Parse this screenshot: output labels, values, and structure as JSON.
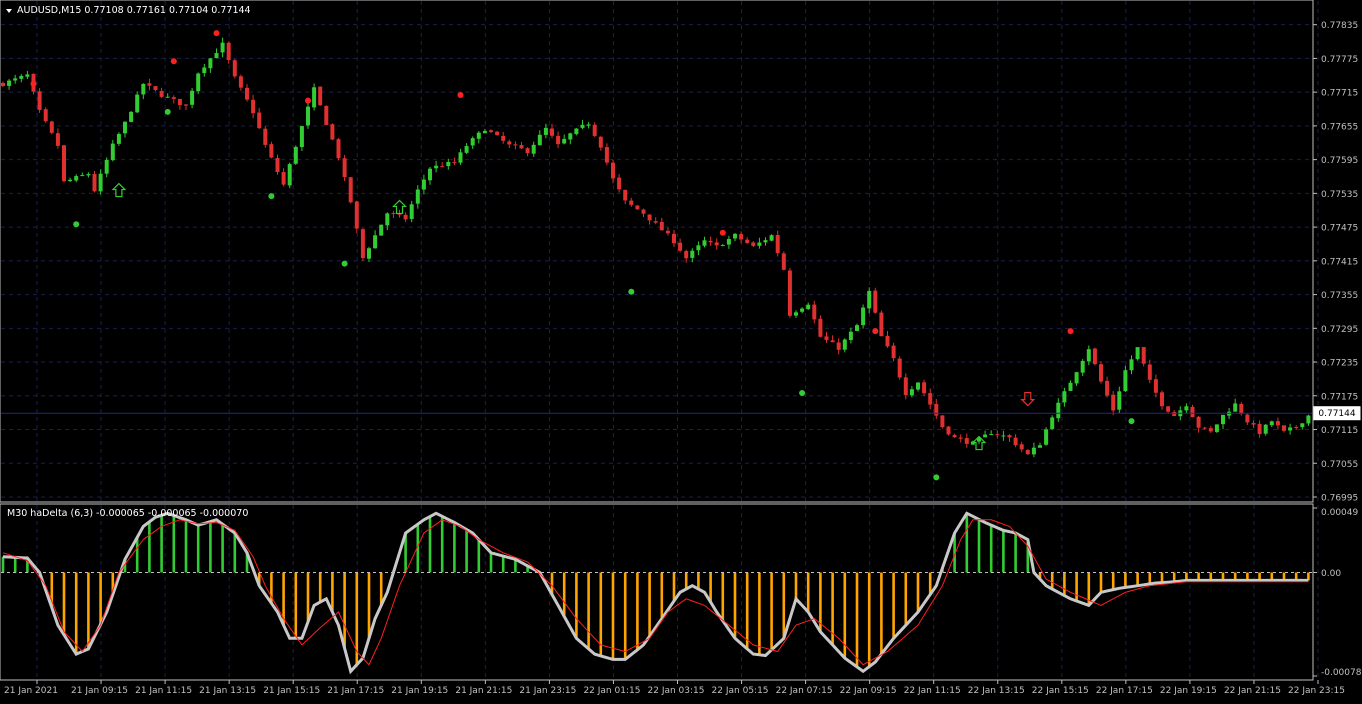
{
  "main_chart": {
    "header": "AUDUSD,M15  0.77108 0.77161 0.77104 0.77144",
    "current_price_label": "0.77144",
    "y_ticks": [
      "0.77835",
      "0.77775",
      "0.77715",
      "0.77655",
      "0.77595",
      "0.77535",
      "0.77475",
      "0.77415",
      "0.77355",
      "0.77295",
      "0.77235",
      "0.77175",
      "0.77115",
      "0.77055",
      "0.76995"
    ]
  },
  "indicator": {
    "header": "M30 haDelta (6,3) -0.000065 -0.000065 -0.000070",
    "y_ticks": [
      "0.00049",
      "0.00",
      "-0.000786"
    ]
  },
  "x_ticks": [
    "21 Jan 2021",
    "21 Jan 09:15",
    "21 Jan 11:15",
    "21 Jan 13:15",
    "21 Jan 15:15",
    "21 Jan 17:15",
    "21 Jan 19:15",
    "21 Jan 21:15",
    "21 Jan 23:15",
    "22 Jan 01:15",
    "22 Jan 03:15",
    "22 Jan 05:15",
    "22 Jan 07:15",
    "22 Jan 09:15",
    "22 Jan 11:15",
    "22 Jan 13:15",
    "22 Jan 15:15",
    "22 Jan 17:15",
    "22 Jan 19:15",
    "22 Jan 21:15",
    "22 Jan 23:15"
  ],
  "colors": {
    "background": "#000000",
    "grid": "#1a2050",
    "axis": "#c0c0c0",
    "bull": "#32cd32",
    "bear": "#e03030",
    "hist_pos": "#32cd32",
    "hist_neg": "#ffa500",
    "delta_line": "#c8c8c8",
    "signal_line": "#ff2020"
  },
  "chart_data": [
    {
      "type": "candlestick",
      "symbol": "AUDUSD",
      "timeframe": "M15",
      "ylim": [
        0.76995,
        0.7787
      ],
      "close_path": [
        [
          0,
          0.7773
        ],
        [
          4,
          0.77745
        ],
        [
          6,
          0.7768
        ],
        [
          9,
          0.7762
        ],
        [
          10,
          0.77555
        ],
        [
          14,
          0.7757
        ],
        [
          15,
          0.7754
        ],
        [
          18,
          0.7762
        ],
        [
          20,
          0.7766
        ],
        [
          23,
          0.7773
        ],
        [
          26,
          0.7771
        ],
        [
          30,
          0.7769
        ],
        [
          32,
          0.7775
        ],
        [
          36,
          0.778
        ],
        [
          38,
          0.7774
        ],
        [
          41,
          0.7768
        ],
        [
          43,
          0.7762
        ],
        [
          46,
          0.7755
        ],
        [
          48,
          0.7762
        ],
        [
          51,
          0.7772
        ],
        [
          53,
          0.7766
        ],
        [
          55,
          0.776
        ],
        [
          57,
          0.7752
        ],
        [
          59,
          0.7742
        ],
        [
          61,
          0.7746
        ],
        [
          63,
          0.775
        ],
        [
          66,
          0.7749
        ],
        [
          68,
          0.7754
        ],
        [
          70,
          0.7758
        ],
        [
          74,
          0.7759
        ],
        [
          76,
          0.7762
        ],
        [
          79,
          0.7765
        ],
        [
          83,
          0.7762
        ],
        [
          86,
          0.7761
        ],
        [
          89,
          0.7765
        ],
        [
          91,
          0.7762
        ],
        [
          93,
          0.7764
        ],
        [
          96,
          0.7766
        ],
        [
          98,
          0.7762
        ],
        [
          100,
          0.7756
        ],
        [
          102,
          0.7752
        ],
        [
          105,
          0.775
        ],
        [
          107,
          0.7748
        ],
        [
          110,
          0.7745
        ],
        [
          112,
          0.7742
        ],
        [
          115,
          0.7745
        ],
        [
          117,
          0.7744
        ],
        [
          120,
          0.7746
        ],
        [
          123,
          0.7744
        ],
        [
          126,
          0.7746
        ],
        [
          128,
          0.774
        ],
        [
          129,
          0.7732
        ],
        [
          132,
          0.7734
        ],
        [
          134,
          0.7728
        ],
        [
          137,
          0.7726
        ],
        [
          140,
          0.773
        ],
        [
          142,
          0.7736
        ],
        [
          144,
          0.7728
        ],
        [
          146,
          0.7724
        ],
        [
          148,
          0.7718
        ],
        [
          150,
          0.772
        ],
        [
          152,
          0.7716
        ],
        [
          154,
          0.7712
        ],
        [
          156,
          0.771
        ],
        [
          159,
          0.7709
        ],
        [
          162,
          0.7711
        ],
        [
          165,
          0.771
        ],
        [
          168,
          0.7707
        ],
        [
          170,
          0.7709
        ],
        [
          172,
          0.7714
        ],
        [
          174,
          0.7718
        ],
        [
          176,
          0.7722
        ],
        [
          178,
          0.7726
        ],
        [
          180,
          0.772
        ],
        [
          182,
          0.7715
        ],
        [
          184,
          0.7722
        ],
        [
          186,
          0.7726
        ],
        [
          188,
          0.772
        ],
        [
          190,
          0.7716
        ],
        [
          192,
          0.7714
        ],
        [
          194,
          0.7716
        ],
        [
          196,
          0.7712
        ],
        [
          198,
          0.7711
        ],
        [
          200,
          0.7714
        ],
        [
          202,
          0.7716
        ],
        [
          204,
          0.7713
        ],
        [
          206,
          0.7711
        ],
        [
          208,
          0.7713
        ],
        [
          210,
          0.7711
        ],
        [
          212,
          0.7712
        ],
        [
          214,
          0.7714
        ]
      ],
      "current_price": 0.77144,
      "fractal_up": [
        [
          5,
          0.7773
        ],
        [
          28,
          0.7777
        ],
        [
          35,
          0.7782
        ],
        [
          50,
          0.777
        ],
        [
          75,
          0.7771
        ],
        [
          118,
          0.77465
        ],
        [
          143,
          0.7729
        ],
        [
          175,
          0.7729
        ]
      ],
      "fractal_down": [
        [
          12,
          0.7748
        ],
        [
          27,
          0.7768
        ],
        [
          44,
          0.7753
        ],
        [
          56,
          0.7741
        ],
        [
          103,
          0.7736
        ],
        [
          131,
          0.7718
        ],
        [
          153,
          0.7703
        ],
        [
          185,
          0.7713
        ]
      ],
      "arrow_up": [
        [
          19,
          0.7754
        ],
        [
          65,
          0.7751
        ],
        [
          160,
          0.7709
        ]
      ],
      "arrow_down": [
        [
          168,
          0.7717
        ]
      ]
    },
    {
      "type": "histogram",
      "name": "haDelta (6,3)",
      "ylim": [
        -0.000786,
        0.00049
      ],
      "delta_path": [
        [
          0,
          0.00012
        ],
        [
          4,
          0.00011
        ],
        [
          6,
          0.0
        ],
        [
          9,
          -0.0004
        ],
        [
          12,
          -0.00062
        ],
        [
          14,
          -0.00058
        ],
        [
          17,
          -0.0003
        ],
        [
          20,
          0.0001
        ],
        [
          23,
          0.00035
        ],
        [
          25,
          0.00042
        ],
        [
          27,
          0.00045
        ],
        [
          30,
          0.0004
        ],
        [
          32,
          0.00036
        ],
        [
          35,
          0.0004
        ],
        [
          38,
          0.0003
        ],
        [
          40,
          0.00015
        ],
        [
          42,
          -0.0001
        ],
        [
          45,
          -0.0003
        ],
        [
          47,
          -0.0005
        ],
        [
          49,
          -0.0005
        ],
        [
          51,
          -0.00025
        ],
        [
          53,
          -0.0002
        ],
        [
          55,
          -0.0004
        ],
        [
          57,
          -0.00075
        ],
        [
          59,
          -0.00065
        ],
        [
          61,
          -0.00035
        ],
        [
          63,
          -0.00015
        ],
        [
          66,
          0.0003
        ],
        [
          69,
          0.0004
        ],
        [
          71,
          0.00045
        ],
        [
          74,
          0.00038
        ],
        [
          77,
          0.0003
        ],
        [
          80,
          0.00015
        ],
        [
          84,
          0.0001
        ],
        [
          88,
          0.0
        ],
        [
          91,
          -0.00025
        ],
        [
          94,
          -0.0005
        ],
        [
          97,
          -0.00062
        ],
        [
          100,
          -0.00066
        ],
        [
          102,
          -0.00066
        ],
        [
          105,
          -0.00055
        ],
        [
          108,
          -0.00035
        ],
        [
          111,
          -0.00015
        ],
        [
          113,
          -0.0001
        ],
        [
          115,
          -0.00015
        ],
        [
          117,
          -0.0003
        ],
        [
          120,
          -0.0005
        ],
        [
          123,
          -0.00062
        ],
        [
          125,
          -0.00063
        ],
        [
          128,
          -0.0005
        ],
        [
          130,
          -0.0002
        ],
        [
          132,
          -0.0003
        ],
        [
          134,
          -0.00045
        ],
        [
          138,
          -0.00065
        ],
        [
          141,
          -0.00075
        ],
        [
          143,
          -0.00068
        ],
        [
          146,
          -0.0005
        ],
        [
          150,
          -0.0003
        ],
        [
          153,
          -0.0001
        ],
        [
          156,
          0.0003
        ],
        [
          158,
          0.00045
        ],
        [
          161,
          0.00038
        ],
        [
          164,
          0.00032
        ],
        [
          166,
          0.0003
        ],
        [
          168,
          0.00025
        ],
        [
          169,
          0.0
        ],
        [
          171,
          -0.0001
        ],
        [
          175,
          -0.0002
        ],
        [
          178,
          -0.00025
        ],
        [
          180,
          -0.00015
        ],
        [
          183,
          -0.00012
        ],
        [
          186,
          -0.0001
        ],
        [
          189,
          -8e-05
        ],
        [
          192,
          -7e-05
        ],
        [
          194,
          -6e-05
        ]
      ],
      "signal_path": [
        [
          0,
          0.00015
        ],
        [
          4,
          9e-05
        ],
        [
          7,
          -0.0001
        ],
        [
          10,
          -0.00045
        ],
        [
          13,
          -0.0006
        ],
        [
          16,
          -0.0004
        ],
        [
          19,
          0.0
        ],
        [
          23,
          0.00025
        ],
        [
          26,
          0.00035
        ],
        [
          29,
          0.0004
        ],
        [
          32,
          0.00037
        ],
        [
          35,
          0.00038
        ],
        [
          38,
          0.00032
        ],
        [
          41,
          0.00012
        ],
        [
          43,
          -0.0001
        ],
        [
          46,
          -0.00035
        ],
        [
          49,
          -0.00055
        ],
        [
          52,
          -0.00042
        ],
        [
          55,
          -0.0003
        ],
        [
          58,
          -0.0006
        ],
        [
          60,
          -0.0007
        ],
        [
          62,
          -0.0005
        ],
        [
          65,
          -0.0001
        ],
        [
          69,
          0.0003
        ],
        [
          72,
          0.0004
        ],
        [
          75,
          0.00035
        ],
        [
          78,
          0.00025
        ],
        [
          82,
          0.00015
        ],
        [
          86,
          8e-05
        ],
        [
          90,
          -0.0001
        ],
        [
          94,
          -0.00035
        ],
        [
          98,
          -0.00055
        ],
        [
          102,
          -0.0006
        ],
        [
          106,
          -0.0005
        ],
        [
          109,
          -0.0003
        ],
        [
          112,
          -0.0002
        ],
        [
          115,
          -0.00025
        ],
        [
          119,
          -0.0004
        ],
        [
          123,
          -0.00055
        ],
        [
          127,
          -0.0006
        ],
        [
          130,
          -0.0004
        ],
        [
          133,
          -0.00035
        ],
        [
          137,
          -0.0005
        ],
        [
          141,
          -0.0007
        ],
        [
          145,
          -0.0006
        ],
        [
          150,
          -0.0004
        ],
        [
          154,
          -0.0001
        ],
        [
          157,
          0.00025
        ],
        [
          159,
          0.0004
        ],
        [
          162,
          0.0004
        ],
        [
          165,
          0.00035
        ],
        [
          168,
          0.0002
        ],
        [
          171,
          -5e-05
        ],
        [
          175,
          -0.00015
        ],
        [
          180,
          -0.00025
        ],
        [
          184,
          -0.00015
        ],
        [
          188,
          -0.0001
        ],
        [
          194,
          -7e-05
        ]
      ]
    }
  ]
}
